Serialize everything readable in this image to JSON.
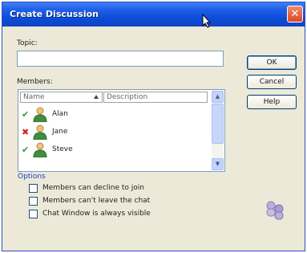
{
  "window": {
    "title": "Create Discussion"
  },
  "topic": {
    "label": "Topic:",
    "value": ""
  },
  "members": {
    "label": "Members:",
    "columns": {
      "name": "Name",
      "description": "Description"
    },
    "rows": [
      {
        "name": "Alan",
        "status": "accepted",
        "status_color": "#2e9a2e"
      },
      {
        "name": "Jane",
        "status": "declined",
        "status_color": "#d42020"
      },
      {
        "name": "Steve",
        "status": "accepted",
        "status_color": "#2e9a2e"
      }
    ]
  },
  "options": {
    "label": "Options",
    "items": [
      {
        "label": "Members can decline to join",
        "checked": false
      },
      {
        "label": "Members can't leave the chat",
        "checked": false
      },
      {
        "label": "Chat Window is always visible",
        "checked": false
      }
    ]
  },
  "buttons": {
    "ok": "OK",
    "cancel": "Cancel",
    "help": "Help"
  },
  "colors": {
    "titlebar": "#0a4bd6",
    "options_label": "#1a3fd0",
    "background": "#ece9d8"
  }
}
